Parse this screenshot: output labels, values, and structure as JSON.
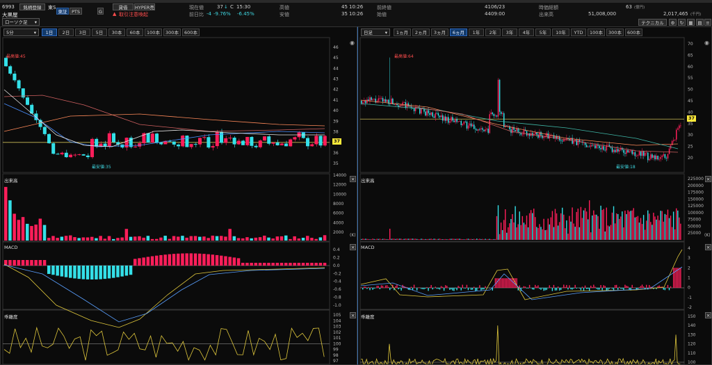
{
  "header": {
    "code": "6993",
    "name": "大黒屋",
    "menu_btn": "銘柄登録",
    "exchange": "東S",
    "chart_type": "ローソク足",
    "venue_tabs": [
      "東証",
      "PTS"
    ],
    "tag_box": "G",
    "loan_btn": "貸借",
    "hyper_btn": "HYPER売",
    "warning": "取引注意喚起",
    "stats": {
      "current_label": "現在値",
      "current_value": "37",
      "current_arrow": "↓",
      "current_mark": "C",
      "current_time": "15:30",
      "change_label": "前日比",
      "change_value": "-4",
      "change_pct1": "-9.76%",
      "change_pct2": "-6.45%",
      "high_label": "高値",
      "high_value": "45",
      "high_time": "10:26",
      "low_label": "安値",
      "low_value": "35",
      "low_time": "10:26",
      "prev_label": "前終値",
      "prev_value": "41",
      "prev_date": "06/23",
      "open_label": "始値",
      "open_value": "44",
      "open_time": "09:00",
      "mcap_label": "時価総額",
      "mcap_value": "63",
      "mcap_unit": "(億円)",
      "volume_label": "出来高",
      "volume_value": "51,008,000",
      "turnover_value": "2,017,465",
      "turnover_unit": "(千円)"
    },
    "tech_btn": "テクニカル"
  },
  "left": {
    "interval": "5分",
    "tabs": [
      "1日",
      "2日",
      "3日",
      "5日",
      "30本",
      "60本",
      "100本",
      "300本",
      "600本"
    ],
    "selected_tab": 0,
    "hi_label": "最高値:45",
    "lo_label": "最安値:35",
    "price_tag": "37",
    "price_axis": [
      "46",
      "45",
      "44",
      "43",
      "42",
      "41",
      "40",
      "39",
      "38",
      "37",
      "36",
      "35"
    ],
    "volume_title": "出来高",
    "volume_axis": [
      "14000",
      "12000",
      "10000",
      "8000",
      "6000",
      "4000",
      "2000"
    ],
    "volume_unit": "(K)",
    "macd_title": "MACD",
    "macd_axis": [
      "0.4",
      "0.2",
      "0.0",
      "-0.2",
      "-0.4",
      "-0.6",
      "-0.8",
      "-1.0"
    ],
    "osc_title": "乖離度",
    "osc_axis": [
      "105",
      "104",
      "103",
      "102",
      "101",
      "100",
      "99",
      "98",
      "97"
    ]
  },
  "right": {
    "interval": "日足",
    "tabs": [
      "1ヵ月",
      "2ヵ月",
      "3ヵ月",
      "6ヵ月",
      "1年",
      "2年",
      "3年",
      "4年",
      "5年",
      "10年",
      "YTD",
      "100本",
      "300本",
      "600本"
    ],
    "selected_tab": 3,
    "hi_label": "最高値:64",
    "lo_label": "最安値:18",
    "price_tag": "37",
    "price_axis": [
      "70",
      "65",
      "60",
      "55",
      "50",
      "45",
      "40",
      "35",
      "30",
      "25",
      "20"
    ],
    "volume_title": "出来高",
    "volume_axis": [
      "225000",
      "200000",
      "175000",
      "150000",
      "125000",
      "100000",
      "75000",
      "50000",
      "25000"
    ],
    "volume_unit": "(K)",
    "macd_title": "MACD",
    "macd_axis": [
      "4",
      "3",
      "2",
      "1",
      "0",
      "-1",
      "-2"
    ],
    "osc_title": "乖離度",
    "osc_axis": [
      "150",
      "140",
      "130",
      "120",
      "110",
      "100"
    ]
  },
  "colors": {
    "up": "#ff1e5a",
    "down": "#34e0e8",
    "ma_short": "#e8e8e8",
    "ma_mid": "#4a8fff",
    "ma_long1": "#d06060",
    "ma_long2": "#ff8a5a",
    "macd_line": "#e0c83c",
    "signal_line": "#5aa0ff",
    "ref_line": "#cbbd56"
  }
}
